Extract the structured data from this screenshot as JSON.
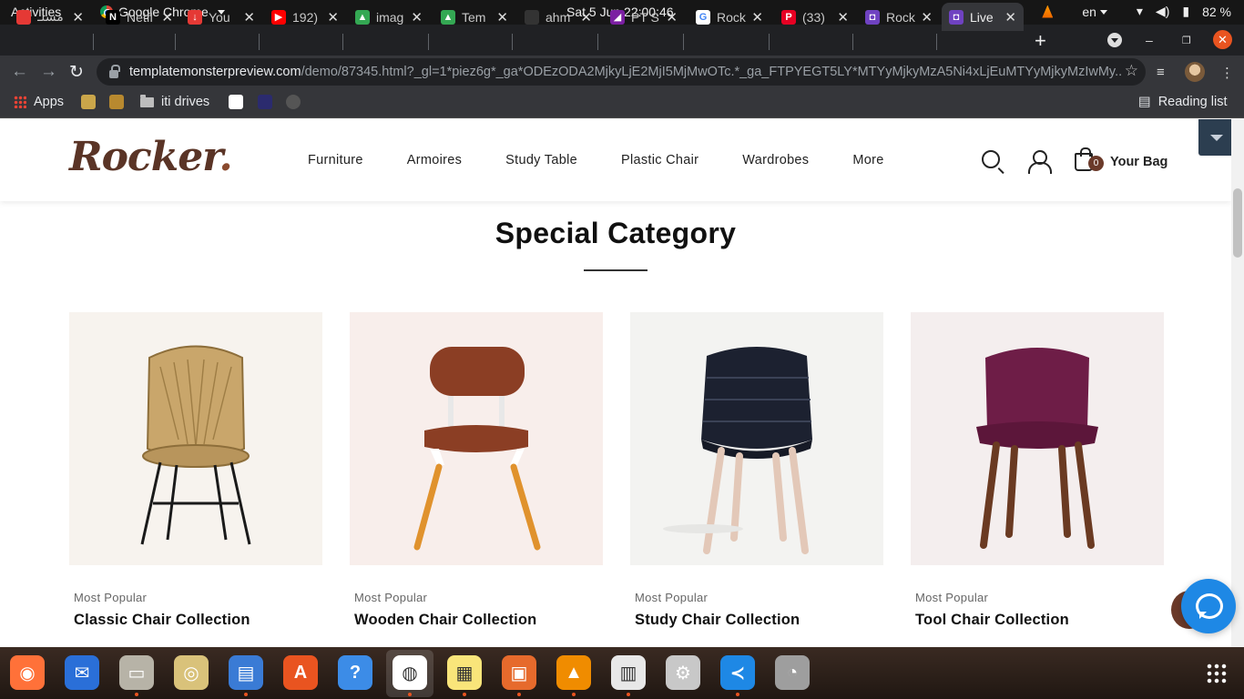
{
  "system": {
    "activities": "Activities",
    "app_name": "Google Chrome",
    "clock": "Sat 5 Jun  22:00:46",
    "lang": "en",
    "battery": "82 %"
  },
  "tabs": [
    {
      "title": "مسلـ",
      "color": "#e53935",
      "glyph": ""
    },
    {
      "title": "Netfl",
      "color": "#000000",
      "glyph": "N"
    },
    {
      "title": "You",
      "color": "#e53935",
      "glyph": "↓"
    },
    {
      "title": "192)",
      "color": "#ff0000",
      "glyph": "▶"
    },
    {
      "title": "imag",
      "color": "#34a853",
      "glyph": "▲"
    },
    {
      "title": "Tem",
      "color": "#34a853",
      "glyph": "▲"
    },
    {
      "title": "ahm",
      "color": "#333333",
      "glyph": ""
    },
    {
      "title": "PT S",
      "color": "#7b1fa2",
      "glyph": "◢"
    },
    {
      "title": "Rock",
      "color": "#ffffff",
      "glyph": "G"
    },
    {
      "title": "(33)",
      "color": "#e60023",
      "glyph": "P"
    },
    {
      "title": "Rock",
      "color": "#6f42c1",
      "glyph": "◘"
    },
    {
      "title": "Live",
      "color": "#6f42c1",
      "glyph": "◘",
      "active": true
    }
  ],
  "omnibox": {
    "host": "templatemonsterpreview.com",
    "path": "/demo/87345.html?_gl=1*piez6g*_ga*ODEzODA2MjkyLjE2MjI5MjMwOTc.*_ga_FTPYEGT5LY*MTYyMjkyMzA5Ni4xLjEuMTYyMjkyMzIwMy..."
  },
  "bookmarks": {
    "apps": "Apps",
    "folder": "iti drives",
    "reading_list": "Reading list"
  },
  "site": {
    "logo": "Rocker",
    "logo_dot": ".",
    "nav": [
      "Furniture",
      "Armoires",
      "Study Table",
      "Plastic Chair",
      "Wardrobes",
      "More"
    ],
    "bag_count": "0",
    "bag_label": "Your Bag",
    "section_title": "Special Category",
    "products": [
      {
        "category": "Most Popular",
        "name": "Classic Chair Collection",
        "bg": "#f7f3ee"
      },
      {
        "category": "Most Popular",
        "name": "Wooden Chair Collection",
        "bg": "#f8eeeb"
      },
      {
        "category": "Most Popular",
        "name": "Study Chair Collection",
        "bg": "#f3f3f1"
      },
      {
        "category": "Most Popular",
        "name": "Tool Chair Collection",
        "bg": "#f4eeee"
      }
    ]
  },
  "dock": [
    "firefox-icon",
    "thunderbird-icon",
    "files-icon",
    "rhythmbox-icon",
    "writer-icon",
    "software-icon",
    "help-icon",
    "chrome-icon",
    "notes-icon",
    "impress-icon",
    "vlc-icon",
    "document-viewer-icon",
    "settings-icon",
    "vscode-icon",
    "disk-icon"
  ]
}
